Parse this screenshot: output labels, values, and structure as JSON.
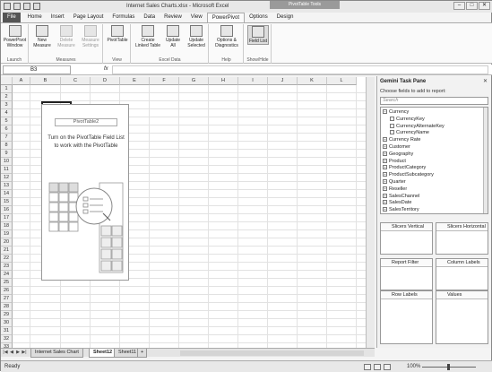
{
  "window": {
    "title": "Internet Sales Charts.xlsx - Microsoft Excel",
    "context_tab": "PivotTable Tools",
    "controls": [
      "–",
      "□",
      "✕"
    ]
  },
  "ribbon_tabs": [
    {
      "label": "File",
      "kind": "file"
    },
    {
      "label": "Home"
    },
    {
      "label": "Insert"
    },
    {
      "label": "Page Layout"
    },
    {
      "label": "Formulas"
    },
    {
      "label": "Data"
    },
    {
      "label": "Review"
    },
    {
      "label": "View"
    },
    {
      "label": "PowerPivot",
      "active": true
    },
    {
      "label": "Options"
    },
    {
      "label": "Design"
    }
  ],
  "ribbon": {
    "launch": {
      "group": "Launch",
      "powerpivot_window": "PowerPivot Window"
    },
    "measures": {
      "group": "Measures",
      "new_measure": "New Measure",
      "delete_measure": "Delete Measure",
      "measure_settings": "Measure Settings"
    },
    "view": {
      "group": "View",
      "pivottable": "PivotTable"
    },
    "excel_data": {
      "group": "Excel Data",
      "create_linked_table": "Create Linked Table",
      "update_all": "Update All",
      "update_selected": "Update Selected"
    },
    "help": {
      "group": "Help",
      "options_diagnostics": "Options & Diagnostics"
    },
    "show_hide": {
      "group": "Show/Hide",
      "field_list": "Field List"
    }
  },
  "formula_bar": {
    "name_box": "B3",
    "fx": "fx",
    "value": ""
  },
  "columns": [
    "A",
    "B",
    "C",
    "D",
    "E",
    "F",
    "G",
    "H",
    "I",
    "J",
    "K",
    "L"
  ],
  "rows": [
    "1",
    "2",
    "3",
    "4",
    "5",
    "6",
    "7",
    "8",
    "9",
    "10",
    "11",
    "12",
    "13",
    "14",
    "15",
    "16",
    "17",
    "18",
    "19",
    "20",
    "21",
    "22",
    "23",
    "24",
    "25",
    "26",
    "27",
    "28",
    "29",
    "30",
    "31",
    "32",
    "33"
  ],
  "pivot_placeholder": {
    "title": "PivotTable2",
    "message": "Turn on the PivotTable Field List to work with the PivotTable"
  },
  "sheet_tabs": [
    {
      "label": "Internet Sales Chart"
    },
    {
      "label": "Sheet12",
      "active": true
    },
    {
      "label": "Sheet11"
    }
  ],
  "status": {
    "ready": "Ready",
    "zoom": "100%"
  },
  "task_pane": {
    "title": "Gemini Task Pane",
    "subtitle": "Choose fields to add to report:",
    "search_placeholder": "Search",
    "fields": [
      {
        "label": "Currency",
        "type": "expanded",
        "indent": 0
      },
      {
        "label": "CurrencyKey",
        "type": "check",
        "indent": 1
      },
      {
        "label": "CurrencyAlternateKey",
        "type": "check",
        "indent": 1
      },
      {
        "label": "CurrencyName",
        "type": "check",
        "indent": 1
      },
      {
        "label": "Currency Rate",
        "type": "collapsed",
        "indent": 0
      },
      {
        "label": "Customer",
        "type": "collapsed",
        "indent": 0
      },
      {
        "label": "Geography",
        "type": "collapsed",
        "indent": 0
      },
      {
        "label": "Product",
        "type": "collapsed",
        "indent": 0
      },
      {
        "label": "ProductCategory",
        "type": "collapsed",
        "indent": 0
      },
      {
        "label": "ProductSubcategory",
        "type": "collapsed",
        "indent": 0
      },
      {
        "label": "Quarter",
        "type": "collapsed",
        "indent": 0
      },
      {
        "label": "Reseller",
        "type": "collapsed",
        "indent": 0
      },
      {
        "label": "SalesChannel",
        "type": "collapsed",
        "indent": 0
      },
      {
        "label": "SalesDate",
        "type": "collapsed",
        "indent": 0
      },
      {
        "label": "SalesTerritory",
        "type": "collapsed",
        "indent": 0
      }
    ],
    "zones": {
      "slicers_vertical": "Slicers Vertical",
      "slicers_horizontal": "Slicers Horizontal",
      "report_filter": "Report Filter",
      "column_labels": "Column Labels",
      "row_labels": "Row Labels",
      "values": "Values"
    },
    "values_symbol": "Σ"
  }
}
